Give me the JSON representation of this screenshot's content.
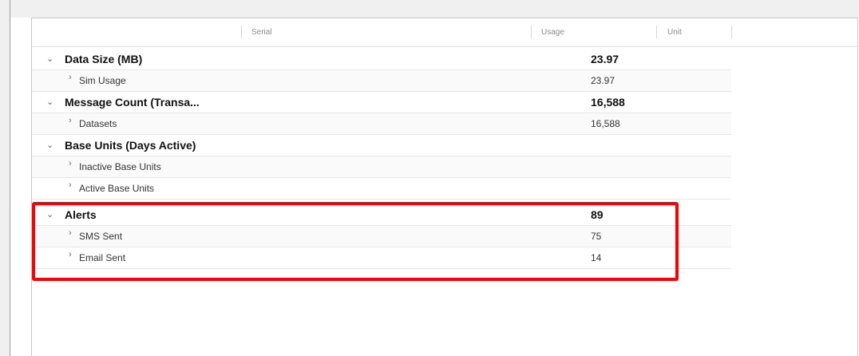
{
  "columns": {
    "serial": "Serial",
    "usage": "Usage",
    "unit": "Unit"
  },
  "groups": [
    {
      "label": "Data Size (MB)",
      "usage": "23.97",
      "children": [
        {
          "label": "Sim Usage",
          "usage": "23.97"
        }
      ]
    },
    {
      "label": "Message Count (Transa...",
      "usage": "16,588",
      "children": [
        {
          "label": "Datasets",
          "usage": "16,588"
        }
      ]
    },
    {
      "label": "Base Units (Days Active)",
      "usage": "",
      "children": [
        {
          "label": "Inactive Base Units",
          "usage": ""
        },
        {
          "label": "Active Base Units",
          "usage": ""
        }
      ]
    },
    {
      "label": "Alerts",
      "usage": "89",
      "children": [
        {
          "label": "SMS Sent",
          "usage": "75"
        },
        {
          "label": "Email Sent",
          "usage": "14"
        }
      ]
    }
  ],
  "icons": {
    "expand": "chevron-down-icon",
    "collapsed": "chevron-right-icon"
  },
  "highlight_color": "#ff0000"
}
